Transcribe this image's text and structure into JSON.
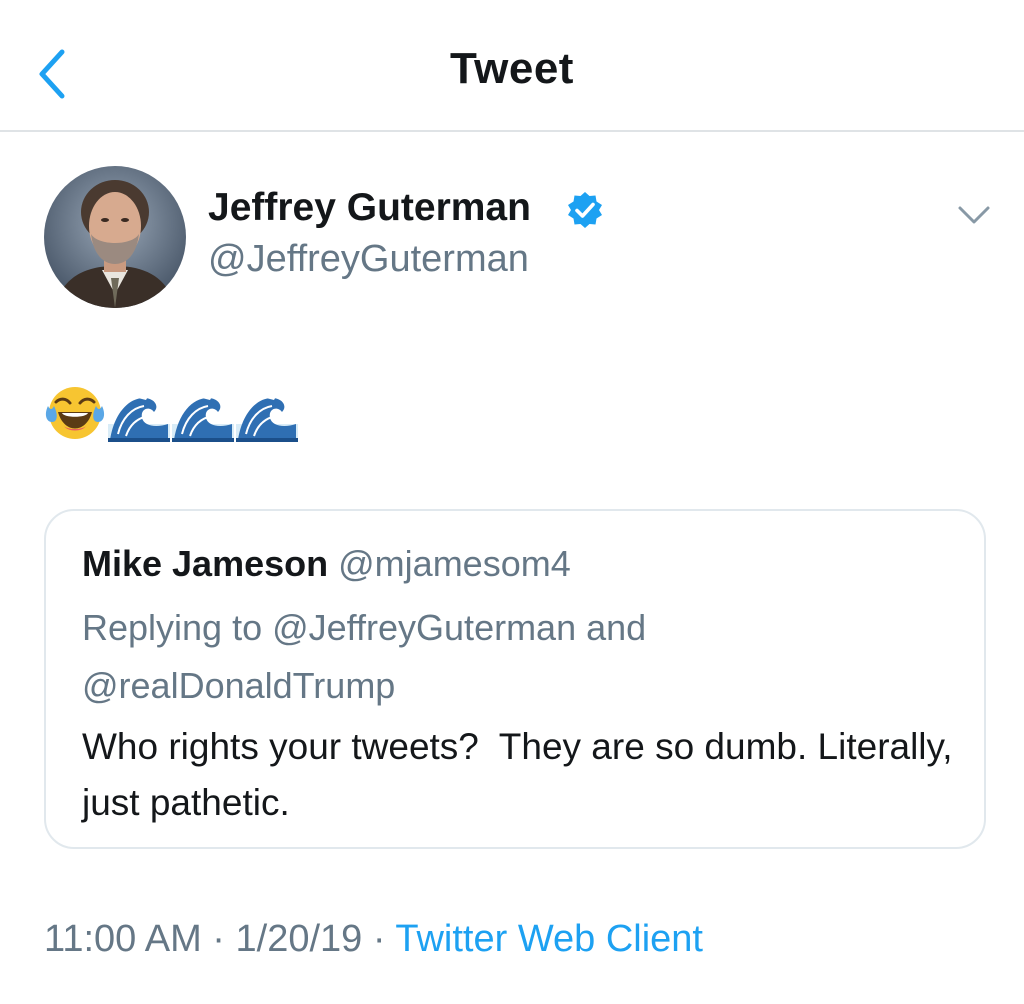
{
  "header": {
    "title": "Tweet",
    "back_icon": "chevron-left-icon",
    "accent_color": "#1da1f2"
  },
  "tweet": {
    "author_name": "Jeffrey Guterman",
    "author_handle": "@JeffreyGuterman",
    "verified": true,
    "verified_icon": "verified-badge-icon",
    "menu_icon": "chevron-down-icon",
    "body_emojis": [
      "face-with-tears-of-joy-icon",
      "water-wave-icon",
      "water-wave-icon",
      "water-wave-icon"
    ],
    "timestamp": "11:00 AM · 1/20/19 · ",
    "source": "Twitter Web Client"
  },
  "quoted_tweet": {
    "author_name": "Mike Jameson",
    "author_handle": "@mjamesom4",
    "replying_to": "Replying to @JeffreyGuterman and @realDonaldTrump",
    "text": "Who rights your tweets?  They are so dumb. Literally, just pathetic."
  }
}
